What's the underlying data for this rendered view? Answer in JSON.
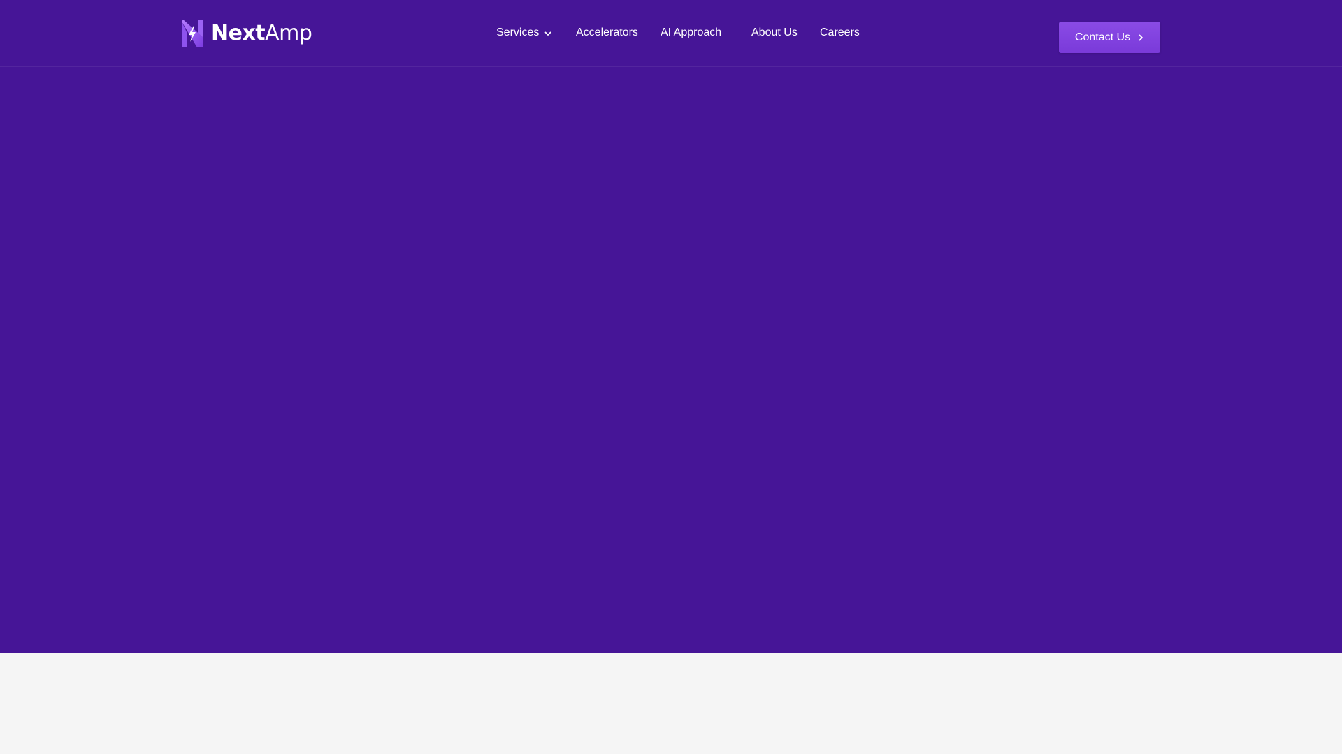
{
  "brand": {
    "name_bold": "Next",
    "name_light": "Amp",
    "logo_icon": "lightning-bolt-icon"
  },
  "nav": {
    "items": [
      {
        "label": "Services",
        "icon": "chevron-down-icon"
      },
      {
        "label": "Accelerators"
      },
      {
        "label": "AI Approach"
      },
      {
        "label": "About Us"
      },
      {
        "label": "Careers"
      }
    ]
  },
  "cta": {
    "label": "Contact Us",
    "icon": "chevron-right-icon"
  },
  "colors": {
    "hero_background": "#461597",
    "page_background": "#f5f5f5",
    "accent": "#8a4be6",
    "text": "#ffffff"
  }
}
